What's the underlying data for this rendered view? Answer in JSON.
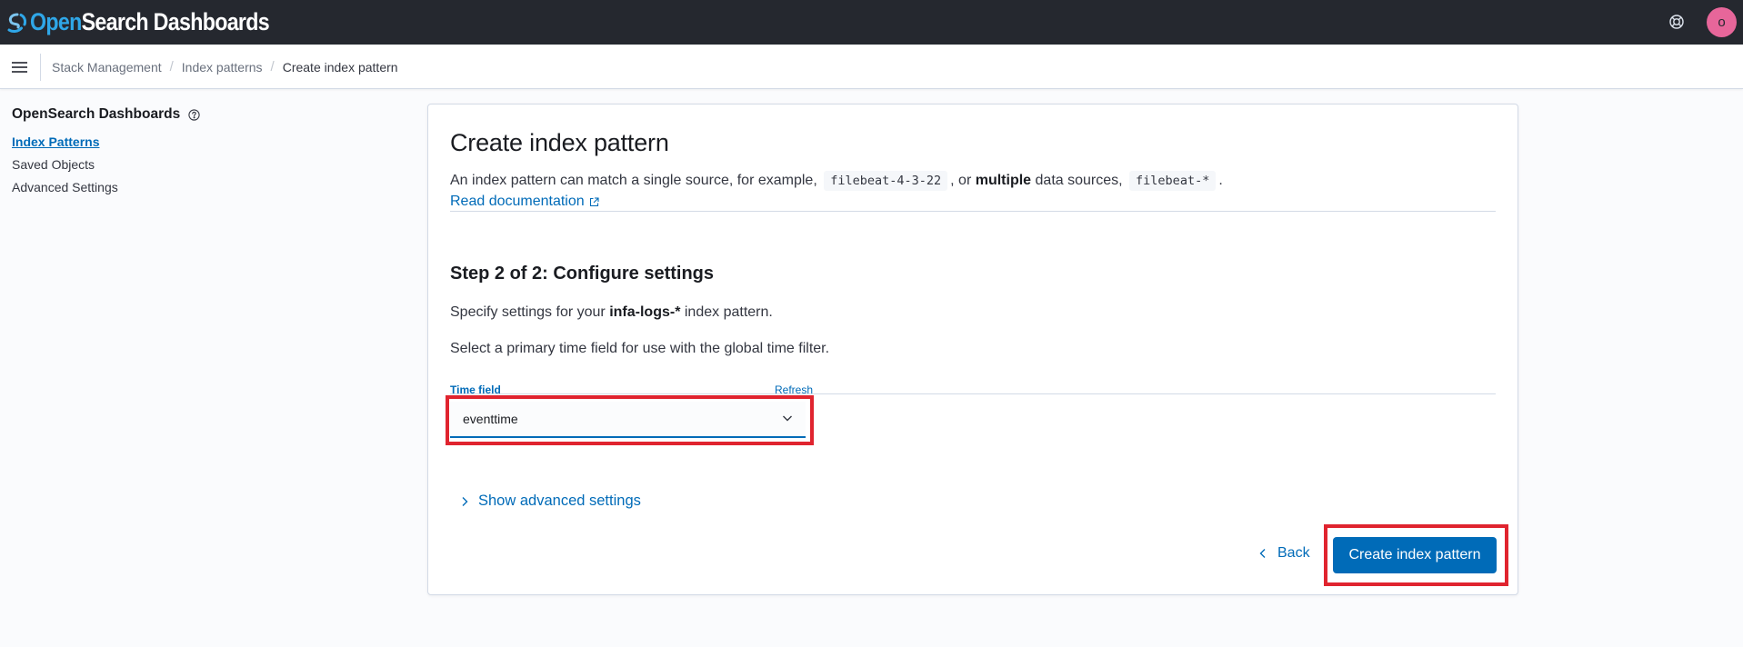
{
  "header": {
    "brand_part1": "Open",
    "brand_part2": "Search Dashboards",
    "avatar_initial": "o",
    "avatar_color": "#e7669a"
  },
  "breadcrumbs": [
    {
      "label": "Stack Management"
    },
    {
      "label": "Index patterns"
    },
    {
      "label": "Create index pattern"
    }
  ],
  "sidenav": {
    "title": "OpenSearch Dashboards",
    "items": [
      {
        "label": "Index Patterns",
        "active": true
      },
      {
        "label": "Saved Objects"
      },
      {
        "label": "Advanced Settings"
      }
    ]
  },
  "main": {
    "title": "Create index pattern",
    "intro_part1": "An index pattern can match a single source, for example,",
    "intro_code1": "filebeat-4-3-22",
    "intro_part2": ", or",
    "intro_bold": "multiple",
    "intro_part3": "data sources,",
    "intro_code2": "filebeat-*",
    "intro_part4": ".",
    "doc_link": "Read documentation",
    "step_title": "Step 2 of 2: Configure settings",
    "settings_prefix": "Specify settings for your",
    "settings_pattern": "infa-logs-*",
    "settings_suffix": "index pattern.",
    "time_hint": "Select a primary time field for use with the global time filter.",
    "time_field_label": "Time field",
    "refresh_label": "Refresh",
    "time_field_value": "eventtime",
    "advanced_toggle": "Show advanced settings",
    "back_label": "Back",
    "create_label": "Create index pattern"
  },
  "colors": {
    "accent": "#006bb8",
    "highlight": "#e0242f",
    "header_bg": "#25282f"
  }
}
